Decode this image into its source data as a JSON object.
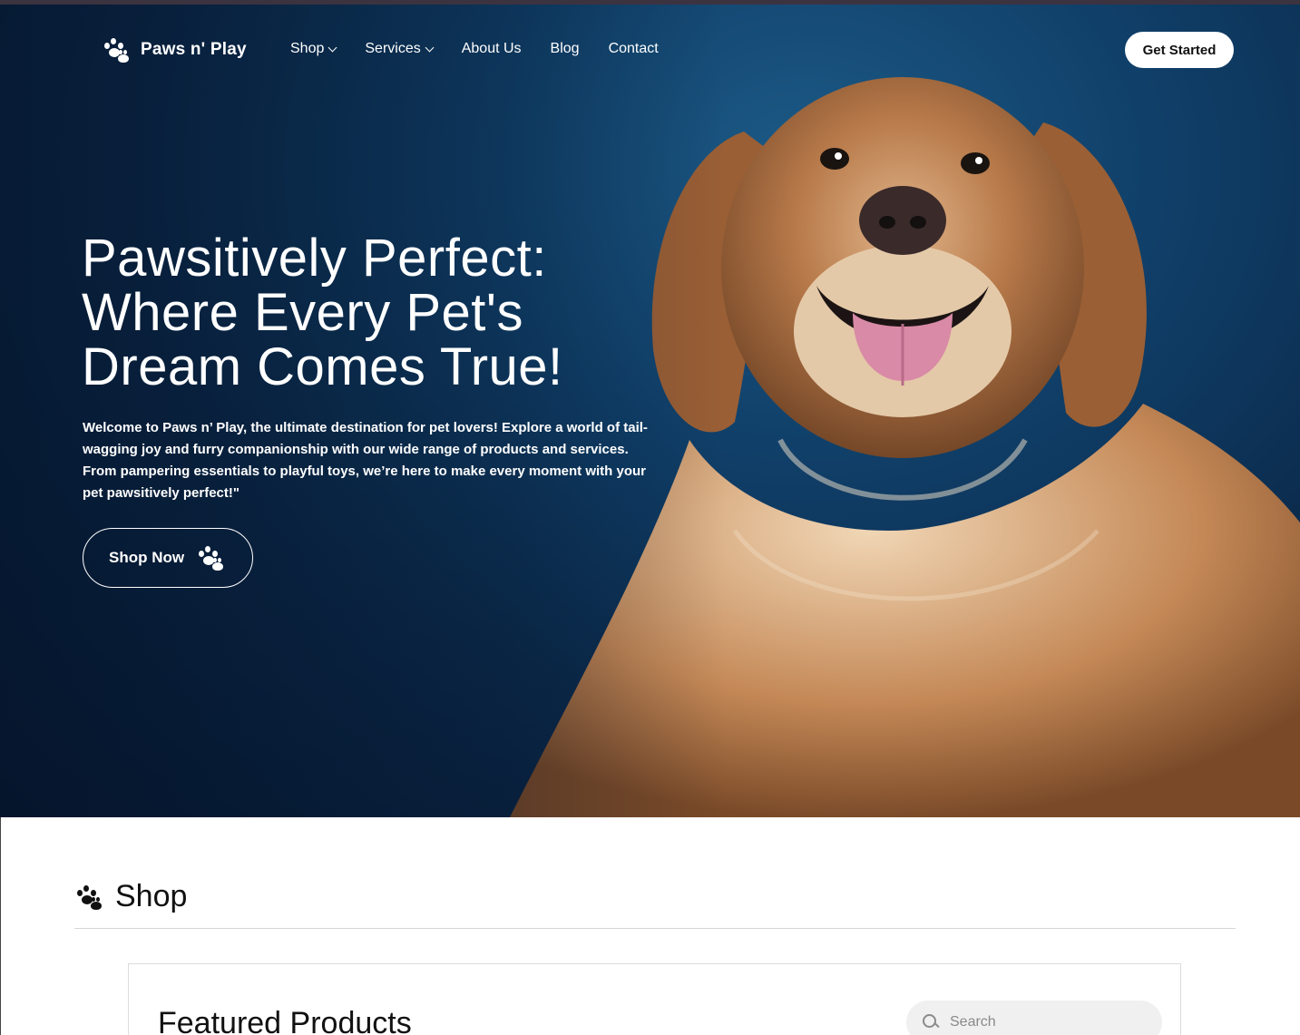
{
  "brand": {
    "name": "Paws n' Play",
    "logo_icon": "paw-icon"
  },
  "nav": {
    "items": [
      {
        "label": "Shop",
        "has_dropdown": true
      },
      {
        "label": "Services",
        "has_dropdown": true
      },
      {
        "label": "About Us",
        "has_dropdown": false
      },
      {
        "label": "Blog",
        "has_dropdown": false
      },
      {
        "label": "Contact",
        "has_dropdown": false
      }
    ],
    "cta_label": "Get Started"
  },
  "hero": {
    "headline_lines": [
      "Pawsitively Perfect:",
      "Where Every Pet's",
      "Dream Comes True!"
    ],
    "intro": "Welcome to Paws n’ Play, the ultimate destination for pet lovers! Explore a world of tail-wagging joy and furry companionship with our wide range of products and services. From pampering essentials to playful toys, we’re here to make every moment with your pet pawsitively perfect!\"",
    "button_label": "Shop Now",
    "button_icon": "paw-icon",
    "image_subject": "golden-retriever-photo"
  },
  "shop": {
    "title": "Shop",
    "title_icon": "paw-icon",
    "featured_title": "Featured Products",
    "search_placeholder": "Search",
    "search_icon": "search-icon"
  },
  "colors": {
    "hero_bg": "#0b2a4b",
    "accent_white": "#ffffff",
    "text_dark": "#111111",
    "top_strip": "#3b3340"
  }
}
